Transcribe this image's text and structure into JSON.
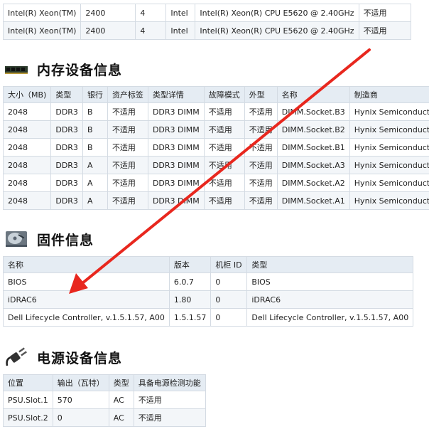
{
  "cpu": {
    "rows": [
      [
        "Intel(R) Xeon(TM)",
        "2400",
        "4",
        "Intel",
        "Intel(R) Xeon(R) CPU E5620 @ 2.40GHz",
        "不适用"
      ],
      [
        "Intel(R) Xeon(TM)",
        "2400",
        "4",
        "Intel",
        "Intel(R) Xeon(R) CPU E5620 @ 2.40GHz",
        "不适用"
      ]
    ]
  },
  "memory": {
    "title": "内存设备信息",
    "icon": "ram-module-icon",
    "headers": [
      "大小（MB)",
      "类型",
      "银行",
      "资产标签",
      "类型详情",
      "故障模式",
      "外型",
      "名称",
      "制造商"
    ],
    "rows": [
      [
        "2048",
        "DDR3",
        "B",
        "不适用",
        "DDR3 DIMM",
        "不适用",
        "不适用",
        "DIMM.Socket.B3",
        "Hynix Semiconductor"
      ],
      [
        "2048",
        "DDR3",
        "B",
        "不适用",
        "DDR3 DIMM",
        "不适用",
        "不适用",
        "DIMM.Socket.B2",
        "Hynix Semiconductor"
      ],
      [
        "2048",
        "DDR3",
        "B",
        "不适用",
        "DDR3 DIMM",
        "不适用",
        "不适用",
        "DIMM.Socket.B1",
        "Hynix Semiconductor"
      ],
      [
        "2048",
        "DDR3",
        "A",
        "不适用",
        "DDR3 DIMM",
        "不适用",
        "不适用",
        "DIMM.Socket.A3",
        "Hynix Semiconductor"
      ],
      [
        "2048",
        "DDR3",
        "A",
        "不适用",
        "DDR3 DIMM",
        "不适用",
        "不适用",
        "DIMM.Socket.A2",
        "Hynix Semiconductor"
      ],
      [
        "2048",
        "DDR3",
        "A",
        "不适用",
        "DDR3 DIMM",
        "不适用",
        "不适用",
        "DIMM.Socket.A1",
        "Hynix Semiconductor"
      ]
    ]
  },
  "firmware": {
    "title": "固件信息",
    "icon": "hard-drive-icon",
    "headers": [
      "名称",
      "版本",
      "机柜 ID",
      "类型"
    ],
    "rows": [
      [
        "BIOS",
        "6.0.7",
        "0",
        "BIOS"
      ],
      [
        "iDRAC6",
        "1.80",
        "0",
        "iDRAC6"
      ],
      [
        "Dell Lifecycle Controller, v.1.5.1.57, A00",
        "1.5.1.57",
        "0",
        "Dell Lifecycle Controller, v.1.5.1.57, A00"
      ]
    ]
  },
  "power": {
    "title": "电源设备信息",
    "icon": "power-plug-icon",
    "headers": [
      "位置",
      "输出（瓦特）",
      "类型",
      "具备电源检测功能"
    ],
    "rows": [
      [
        "PSU.Slot.1",
        "570",
        "AC",
        "不适用"
      ],
      [
        "PSU.Slot.2",
        "0",
        "AC",
        "不适用"
      ]
    ]
  },
  "annotation": {
    "color": "#e8271e"
  }
}
